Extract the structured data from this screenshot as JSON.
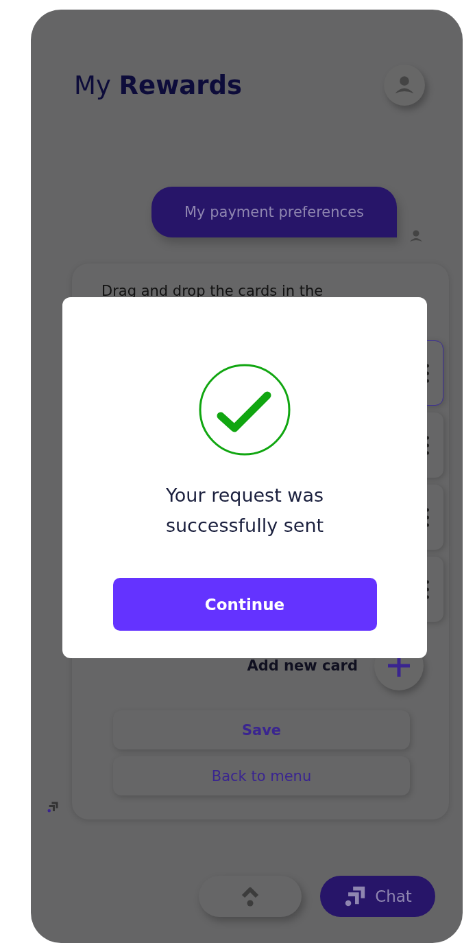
{
  "header": {
    "title": "My **Rewards**"
  },
  "chat_bubble": {
    "text": "My payment preferences"
  },
  "panel": {
    "instruction": "Drag and drop the cards in the",
    "cards": [
      {
        "selected": true
      },
      {
        "selected": false
      },
      {
        "selected": false
      },
      {
        "selected": false
      }
    ],
    "add_card": {
      "label": "Add new card"
    },
    "buttons": [
      {
        "label": "Save",
        "kind": "primary"
      },
      {
        "label": "Back to menu",
        "kind": "secondary"
      }
    ]
  },
  "chat_button": {
    "label": "Chat"
  },
  "modal": {
    "message": "Your request was successfully sent",
    "button": "Continue"
  }
}
